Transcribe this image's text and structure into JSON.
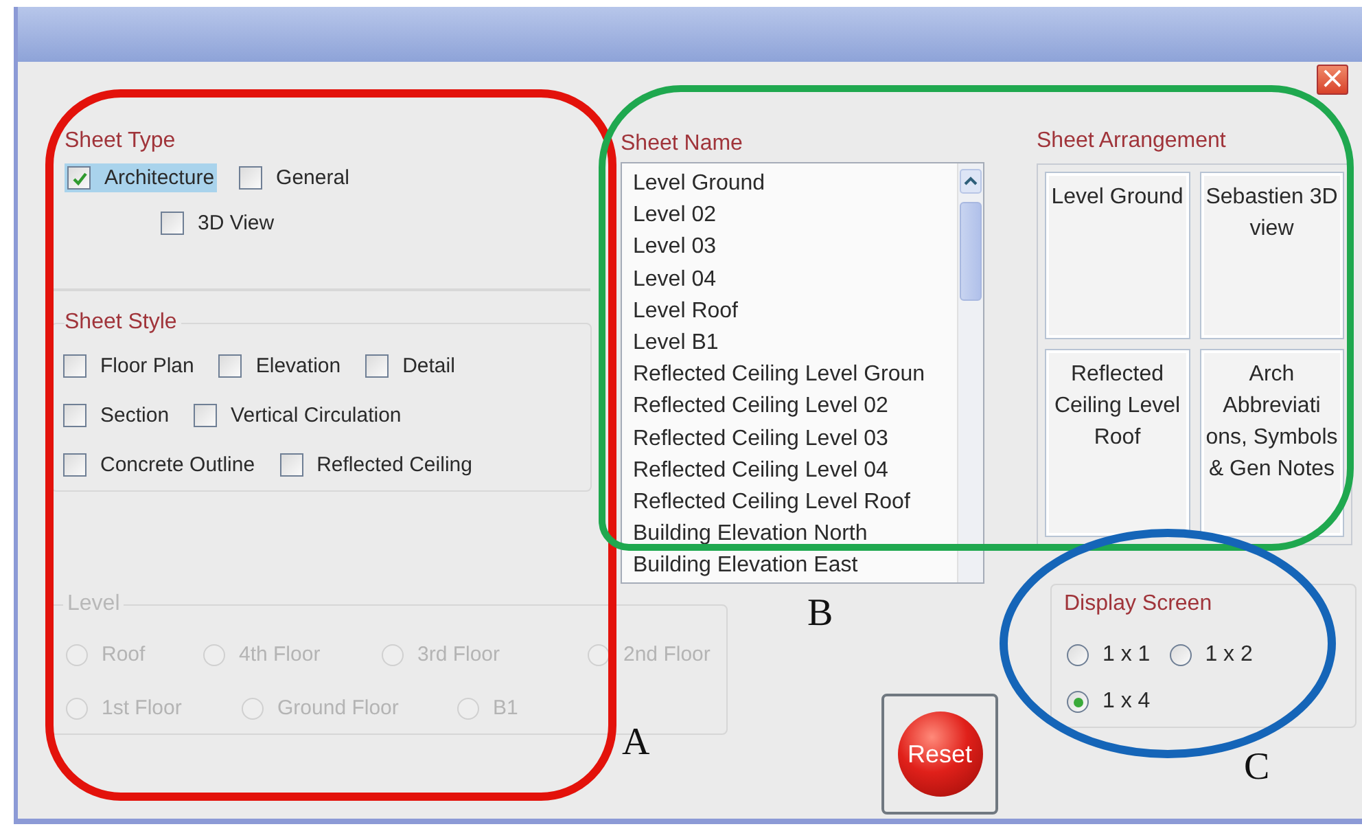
{
  "window": {
    "close_label": "×"
  },
  "sheet_type": {
    "title": "Sheet Type",
    "options": [
      {
        "label": "Architecture",
        "checked": true,
        "focused": true
      },
      {
        "label": "General",
        "checked": false,
        "focused": false
      },
      {
        "label": "3D View",
        "checked": false,
        "focused": false
      }
    ]
  },
  "sheet_style": {
    "title": "Sheet Style",
    "rows": [
      [
        {
          "label": "Floor Plan",
          "checked": false
        },
        {
          "label": "Elevation",
          "checked": false
        },
        {
          "label": "Detail",
          "checked": false
        }
      ],
      [
        {
          "label": "Section",
          "checked": false
        },
        {
          "label": "Vertical Circulation",
          "checked": false
        }
      ],
      [
        {
          "label": "Concrete Outline",
          "checked": false
        },
        {
          "label": "Reflected Ceiling",
          "checked": false
        }
      ]
    ]
  },
  "level": {
    "title": "Level",
    "disabled": true,
    "rows": [
      [
        {
          "label": "Roof",
          "selected": false
        },
        {
          "label": "4th Floor",
          "selected": false
        },
        {
          "label": "3rd Floor",
          "selected": false
        },
        {
          "label": "2nd Floor",
          "selected": false
        }
      ],
      [
        {
          "label": "1st Floor",
          "selected": false
        },
        {
          "label": "Ground Floor",
          "selected": false
        },
        {
          "label": "B1",
          "selected": false
        }
      ]
    ]
  },
  "sheet_name": {
    "title": "Sheet Name",
    "items": [
      "Level Ground",
      "Level 02",
      "Level 03",
      "Level 04",
      "Level Roof",
      "Level B1",
      "Reflected Ceiling Level Groun",
      "Reflected Ceiling Level 02",
      "Reflected Ceiling Level 03",
      "Reflected Ceiling Level 04",
      "Reflected Ceiling Level Roof",
      "Building Elevation North",
      "Building Elevation East"
    ]
  },
  "sheet_arrangement": {
    "title": "Sheet Arrangement",
    "cells": [
      "Level Ground",
      "Sebastien 3D view",
      "Reflected Ceiling Level Roof",
      "Arch Abbreviati ons, Symbols & Gen Notes"
    ]
  },
  "display_screen": {
    "title": "Display Screen",
    "options": [
      {
        "label": "1 x 1",
        "selected": false
      },
      {
        "label": "1 x 2",
        "selected": false
      },
      {
        "label": "1 x 4",
        "selected": true
      }
    ]
  },
  "reset_button": {
    "label": "Reset"
  },
  "annotations": [
    {
      "label": "A",
      "color": "#e3120b"
    },
    {
      "label": "B",
      "color": "#1fa84f"
    },
    {
      "label": "C",
      "color": "#1565b8"
    }
  ]
}
